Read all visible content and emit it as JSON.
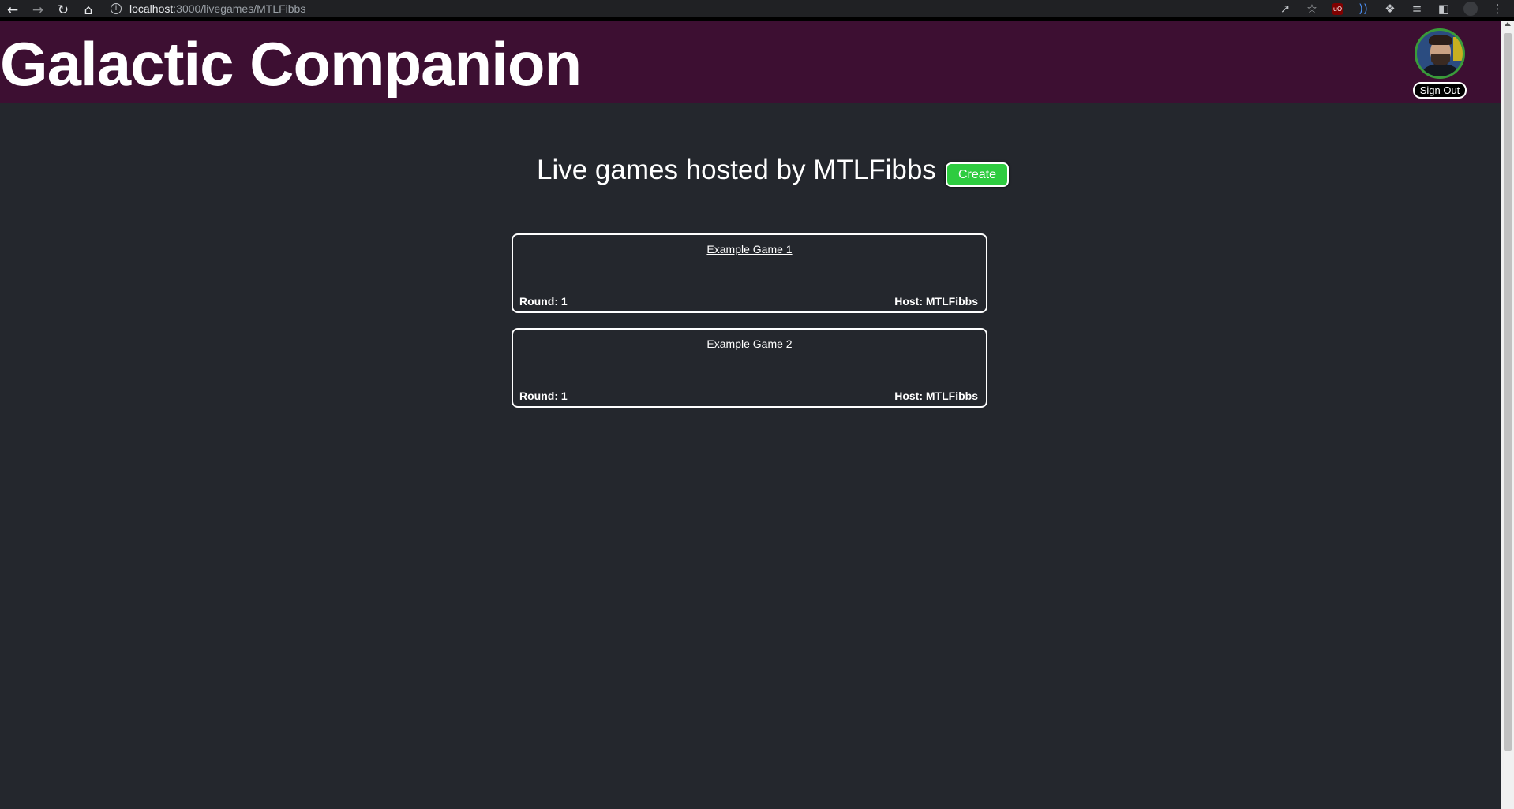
{
  "browser": {
    "url_host": "localhost",
    "url_path": ":3000/livegames/MTLFibbs",
    "icons": [
      "back-icon",
      "forward-icon",
      "reload-icon",
      "home-icon",
      "info-icon",
      "share-icon",
      "star-icon",
      "ublock-icon",
      "extension-icon",
      "puzzle-icon",
      "playlist-icon",
      "sidepanel-icon",
      "profile-icon",
      "menu-icon"
    ],
    "ublock_label": "uO"
  },
  "header": {
    "title": "Galactic Companion",
    "sign_out_label": "Sign Out",
    "background_color": "#3d0f32"
  },
  "main": {
    "heading": "Live games hosted by MTLFibbs",
    "create_label": "Create",
    "create_color": "#2ecc40",
    "games": [
      {
        "name": "Example Game 1",
        "round": "Round: 1",
        "host": "Host: MTLFibbs"
      },
      {
        "name": "Example Game 2",
        "round": "Round: 1",
        "host": "Host: MTLFibbs"
      }
    ]
  }
}
